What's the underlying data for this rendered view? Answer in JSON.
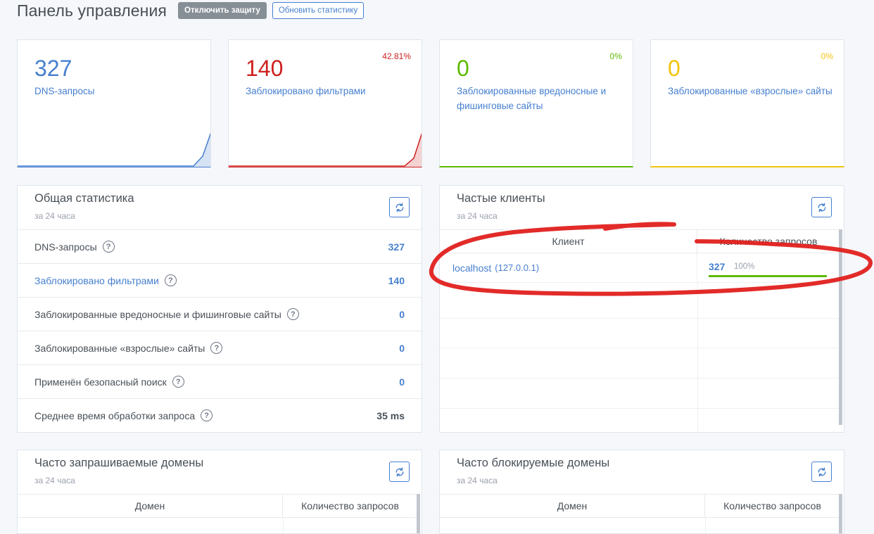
{
  "header": {
    "title": "Панель управления",
    "disable_protection": "Отключить защиту",
    "refresh_stats": "Обновить статистику"
  },
  "cards": [
    {
      "value": "327",
      "label": "DNS-запросы",
      "percent": "",
      "color": "#467fcf"
    },
    {
      "value": "140",
      "label": "Заблокировано фильтрами",
      "percent": "42.81%",
      "color": "#cd201f"
    },
    {
      "value": "0",
      "label": "Заблокированные вредоносные и фишинговые сайты",
      "percent": "0%",
      "color": "#5eba00"
    },
    {
      "value": "0",
      "label": "Заблокированные «взрослые» сайты",
      "percent": "0%",
      "color": "#f1c40f"
    }
  ],
  "general": {
    "title": "Общая статистика",
    "subtitle": "за 24 часа",
    "rows": [
      {
        "label": "DNS-запросы",
        "value": "327"
      },
      {
        "label": "Заблокировано фильтрами",
        "value": "140"
      },
      {
        "label": "Заблокированные вредоносные и фишинговые сайты",
        "value": "0"
      },
      {
        "label": "Заблокированные «взрослые» сайты",
        "value": "0"
      },
      {
        "label": "Применён безопасный поиск",
        "value": "0"
      },
      {
        "label": "Среднее время обработки запроса",
        "value": "35 ms"
      }
    ]
  },
  "clients": {
    "title": "Частые клиенты",
    "subtitle": "за 24 часа",
    "col_client": "Клиент",
    "col_count": "Количество запросов",
    "rows": [
      {
        "name": "localhost",
        "ip": "(127.0.0.1)",
        "count": "327",
        "percent": "100%",
        "share": 1.0
      }
    ]
  },
  "queried": {
    "title": "Часто запрашиваемые домены",
    "subtitle": "за 24 часа",
    "col_domain": "Домен",
    "col_count": "Количество запросов"
  },
  "blocked": {
    "title": "Часто блокируемые домены",
    "subtitle": "за 24 часа",
    "col_domain": "Домен",
    "col_count": "Количество запросов"
  },
  "colors": {
    "accent": "#467fcf",
    "danger": "#cd201f",
    "success": "#5eba00",
    "warning": "#f1c40f",
    "annotation": "#e0201e"
  },
  "icons": {
    "refresh": "refresh-icon",
    "help": "question-circle-icon"
  }
}
